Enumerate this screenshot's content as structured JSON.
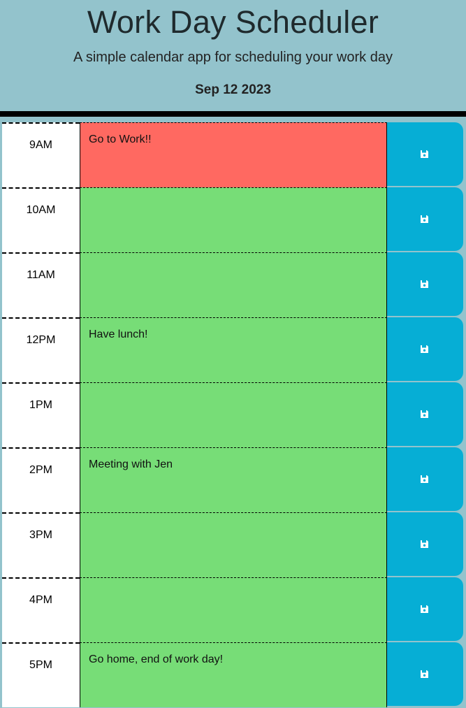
{
  "header": {
    "title": "Work Day Scheduler",
    "subtitle": "A simple calendar app for scheduling your work day",
    "date": "Sep 12 2023"
  },
  "colors": {
    "background": "#93c3cc",
    "present": "#ff6961",
    "future": "#77dd77",
    "save_button": "#06aed5"
  },
  "rows": [
    {
      "hour": "9AM",
      "text": "Go to Work!!",
      "state": "present",
      "save_icon": "save-icon"
    },
    {
      "hour": "10AM",
      "text": "",
      "state": "future",
      "save_icon": "save-icon"
    },
    {
      "hour": "11AM",
      "text": "",
      "state": "future",
      "save_icon": "save-icon"
    },
    {
      "hour": "12PM",
      "text": "Have lunch!",
      "state": "future",
      "save_icon": "save-icon"
    },
    {
      "hour": "1PM",
      "text": "",
      "state": "future",
      "save_icon": "save-icon"
    },
    {
      "hour": "2PM",
      "text": "Meeting with Jen",
      "state": "future",
      "save_icon": "save-icon"
    },
    {
      "hour": "3PM",
      "text": "",
      "state": "future",
      "save_icon": "save-icon"
    },
    {
      "hour": "4PM",
      "text": "",
      "state": "future",
      "save_icon": "save-icon"
    },
    {
      "hour": "5PM",
      "text": "Go home, end of work day!",
      "state": "future",
      "save_icon": "save-icon"
    }
  ]
}
